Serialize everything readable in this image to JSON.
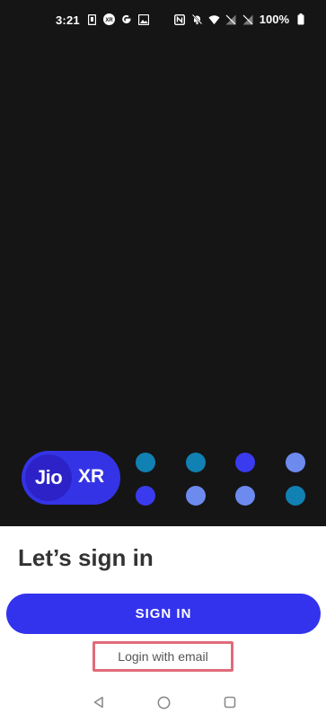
{
  "status_bar": {
    "time": "3:21",
    "left_icons": [
      "sim-card-icon",
      "xr-app-icon",
      "google-icon",
      "image-icon"
    ],
    "right_icons": [
      "nfc-icon",
      "bell-off-icon",
      "wifi-icon",
      "signal-off-icon",
      "signal-off-icon-2"
    ],
    "battery_percent": "100%"
  },
  "brand": {
    "logo_text": "Jio",
    "logo_suffix": "XR",
    "logo_color": "#3434e6",
    "dots": [
      {
        "color": "#1180b2"
      },
      {
        "color": "#1180b2"
      },
      {
        "color": "#3a3aee"
      },
      {
        "color": "#6d8aef"
      },
      {
        "color": "#3a3aee"
      },
      {
        "color": "#6d8aef"
      },
      {
        "color": "#6d8aef"
      },
      {
        "color": "#1180b2"
      }
    ]
  },
  "sheet": {
    "title": "Let’s sign in",
    "sign_in_label": "SIGN IN",
    "email_link_label": "Login with email",
    "accent_color": "#3333ee",
    "highlight_color": "#e06b7a"
  },
  "nav_bar": {
    "buttons": [
      "back-icon",
      "home-icon",
      "recents-icon"
    ]
  }
}
